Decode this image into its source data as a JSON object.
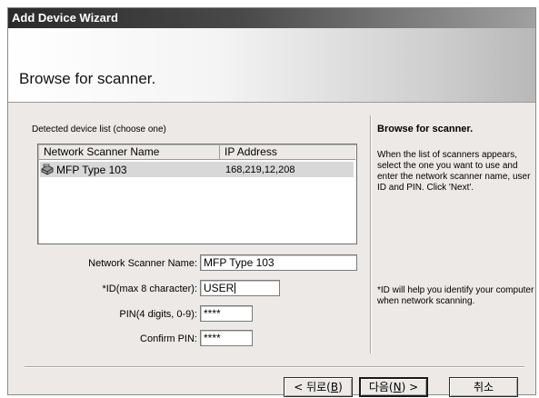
{
  "window": {
    "title": "Add Device Wizard"
  },
  "header": {
    "title": "Browse for scanner."
  },
  "device_list": {
    "label": "Detected device list (choose one)",
    "columns": [
      "Network Scanner Name",
      "IP Address"
    ],
    "rows": [
      {
        "icon": "scanner-icon",
        "name": "MFP Type 103",
        "ip": "168,219,12,208"
      }
    ]
  },
  "form": {
    "name_label": "Network Scanner Name:",
    "name_value": "MFP Type 103",
    "id_label": "*ID(max 8 character):",
    "id_value": "USER",
    "pin_label": "PIN(4 digits, 0-9):",
    "pin_value": "****",
    "confirm_label": "Confirm PIN:",
    "confirm_value": "****"
  },
  "help": {
    "title": "Browse for scanner.",
    "text": "When the list of scanners appears, select the one you want to use and enter the network scanner name, user ID and PIN. Click 'Next'.",
    "note": "*ID will help you identify your computer when network scanning."
  },
  "buttons": {
    "back": {
      "prefix": "< 뒤로(",
      "key": "B",
      "suffix": ")"
    },
    "next": {
      "prefix": "다음(",
      "key": "N",
      "suffix": ") >"
    },
    "cancel": {
      "label": "취소"
    }
  }
}
